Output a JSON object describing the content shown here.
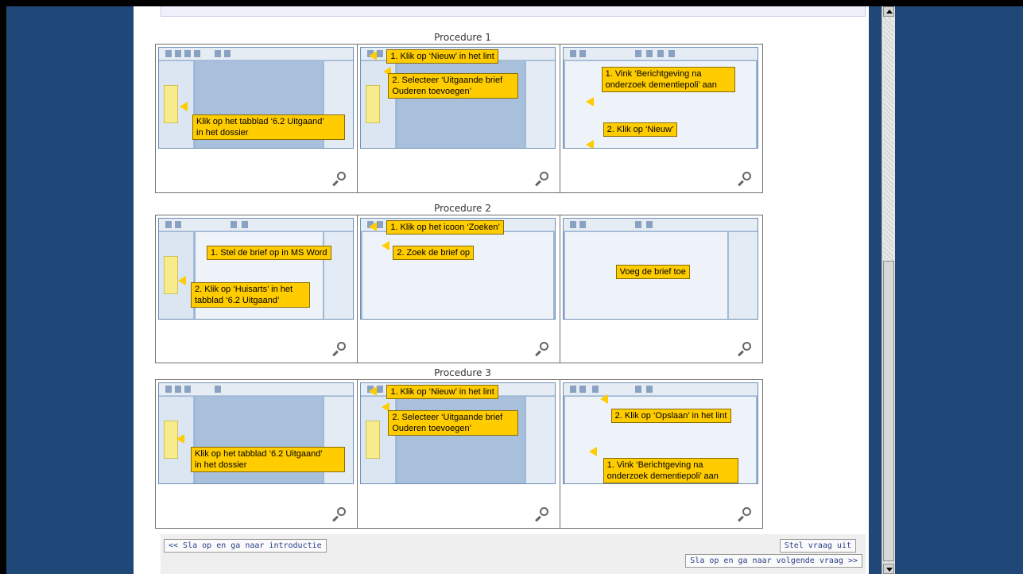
{
  "procedures": [
    {
      "title": "Procedure 1",
      "cells": [
        {
          "callouts": [
            "Klik op het tabblad ‘6.2 Uitgaand’\nin het dossier"
          ]
        },
        {
          "callouts": [
            "1. Klik op ‘Nieuw’ in het lint",
            "2. Selecteer ‘Uitgaande brief\nOuderen toevoegen’"
          ]
        },
        {
          "callouts": [
            "1. Vink ‘Berichtgeving na\nonderzoek dementiepoli’ aan",
            "2. Klik op ‘Nieuw’"
          ]
        }
      ]
    },
    {
      "title": "Procedure 2",
      "cells": [
        {
          "callouts": [
            "1. Stel de brief op in MS Word",
            "2. Klik op ‘Huisarts’ in het\ntabblad ‘6.2 Uitgaand’"
          ]
        },
        {
          "callouts": [
            "1. Klik op het icoon ‘Zoeken’",
            "2. Zoek de brief op"
          ]
        },
        {
          "callouts": [
            "Voeg de brief toe"
          ]
        }
      ]
    },
    {
      "title": "Procedure 3",
      "cells": [
        {
          "callouts": [
            "Klik op het tabblad ‘6.2 Uitgaand’\nin het dossier"
          ]
        },
        {
          "callouts": [
            "1. Klik op ‘Nieuw’ in het lint",
            "2. Selecteer ‘Uitgaande brief\nOuderen toevoegen’"
          ]
        },
        {
          "callouts": [
            "2. Klik op ‘Opslaan’ in het lint",
            "1. Vink ‘Berichtgeving na\nonderzoek dementiepoli’ aan"
          ]
        }
      ]
    }
  ],
  "footer": {
    "back_label": "<< Sla op en ga naar introductie",
    "postpone_label": "Stel vraag uit",
    "next_label": "Sla op en ga naar volgende vraag >>"
  },
  "colors": {
    "background": "#1f4878",
    "callout": "#ffcc00"
  },
  "icons": [
    "magnifier-icon",
    "scroll-up-icon",
    "scroll-down-icon"
  ]
}
